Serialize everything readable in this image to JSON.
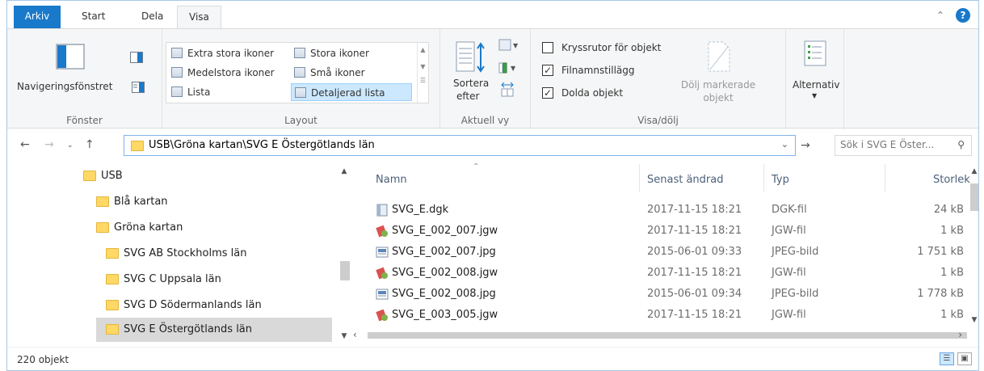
{
  "ribbon_tabs": [
    "Arkiv",
    "Start",
    "Dela",
    "Visa"
  ],
  "ribbon": {
    "fonster": {
      "nav_pane_label": "Navigeringsfönstret",
      "group_label": "Fönster"
    },
    "layout": {
      "items": [
        {
          "label": "Extra stora ikoner",
          "selected": false
        },
        {
          "label": "Stora ikoner",
          "selected": false
        },
        {
          "label": "Medelstora ikoner",
          "selected": false
        },
        {
          "label": "Små ikoner",
          "selected": false
        },
        {
          "label": "Lista",
          "selected": false
        },
        {
          "label": "Detaljerad lista",
          "selected": true
        }
      ],
      "group_label": "Layout"
    },
    "aktuell_vy": {
      "sort_label_1": "Sortera",
      "sort_label_2": "efter",
      "group_label": "Aktuell vy"
    },
    "visa_dolj": {
      "checkboxes": [
        {
          "label": "Kryssrutor för objekt",
          "checked": false
        },
        {
          "label": "Filnamnstillägg",
          "checked": true
        },
        {
          "label": "Dolda objekt",
          "checked": true
        }
      ],
      "hide_selected_1": "Dölj markerade",
      "hide_selected_2": "objekt",
      "group_label": "Visa/dölj"
    },
    "options_label": "Alternativ"
  },
  "address": {
    "path": "USB\\Gröna kartan\\SVG E Östergötlands län",
    "search_placeholder": "Sök i SVG E Öster..."
  },
  "nav_tree": [
    {
      "label": "USB",
      "indent": 0,
      "selected": false
    },
    {
      "label": "Blå kartan",
      "indent": 1,
      "selected": false
    },
    {
      "label": "Gröna kartan",
      "indent": 1,
      "selected": false
    },
    {
      "label": "SVG AB Stockholms län",
      "indent": 2,
      "selected": false
    },
    {
      "label": "SVG C Uppsala län",
      "indent": 2,
      "selected": false
    },
    {
      "label": "SVG D Södermanlands län",
      "indent": 2,
      "selected": false
    },
    {
      "label": "SVG E Östergötlands län",
      "indent": 2,
      "selected": true
    }
  ],
  "columns": {
    "name": "Namn",
    "date": "Senast ändrad",
    "type": "Typ",
    "size": "Storlek"
  },
  "files": [
    {
      "name": "SVG_E.dgk",
      "date": "2017-11-15 18:21",
      "type": "DGK-fil",
      "size": "24 kB",
      "icon": "dgk-file-icon"
    },
    {
      "name": "SVG_E_002_007.jgw",
      "date": "2017-11-15 18:21",
      "type": "JGW-fil",
      "size": "1 kB",
      "icon": "jgw-file-icon"
    },
    {
      "name": "SVG_E_002_007.jpg",
      "date": "2015-06-01 09:33",
      "type": "JPEG-bild",
      "size": "1 751 kB",
      "icon": "jpeg-file-icon"
    },
    {
      "name": "SVG_E_002_008.jgw",
      "date": "2017-11-15 18:21",
      "type": "JGW-fil",
      "size": "1 kB",
      "icon": "jgw-file-icon"
    },
    {
      "name": "SVG_E_002_008.jpg",
      "date": "2015-06-01 09:34",
      "type": "JPEG-bild",
      "size": "1 778 kB",
      "icon": "jpeg-file-icon"
    },
    {
      "name": "SVG_E_003_005.jgw",
      "date": "2017-11-15 18:21",
      "type": "JGW-fil",
      "size": "1 kB",
      "icon": "jgw-file-icon"
    }
  ],
  "status": {
    "count": "220 objekt"
  },
  "colors": {
    "file_tab": "#1979ca",
    "selection": "#cce8ff",
    "folder": "#ffd865"
  }
}
